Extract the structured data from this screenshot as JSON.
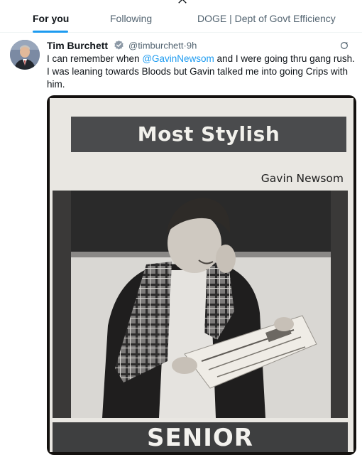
{
  "nav": {
    "logo_icon": "x-logo-icon",
    "tabs": [
      {
        "label": "For you",
        "active": true
      },
      {
        "label": "Following",
        "active": false
      },
      {
        "label": "DOGE | Dept of Govt Efficiency",
        "active": false
      }
    ]
  },
  "post": {
    "author": {
      "name": "Tim Burchett",
      "verified": true,
      "handle": "@timburchett",
      "separator": "·",
      "time": "9h"
    },
    "text": {
      "part1": "I can remember when ",
      "mention": "@GavinNewsom",
      "part2": " and I were going thru gang rush. I was leaning towards Bloods but Gavin talked me into going Crips with him."
    },
    "media": {
      "banner_title": "Most Stylish",
      "name_caption": "Gavin Newsom",
      "banner_bottom": "SENIOR"
    }
  },
  "colors": {
    "accent": "#1d9bf0",
    "text": "#0f1419",
    "muted": "#536471"
  }
}
